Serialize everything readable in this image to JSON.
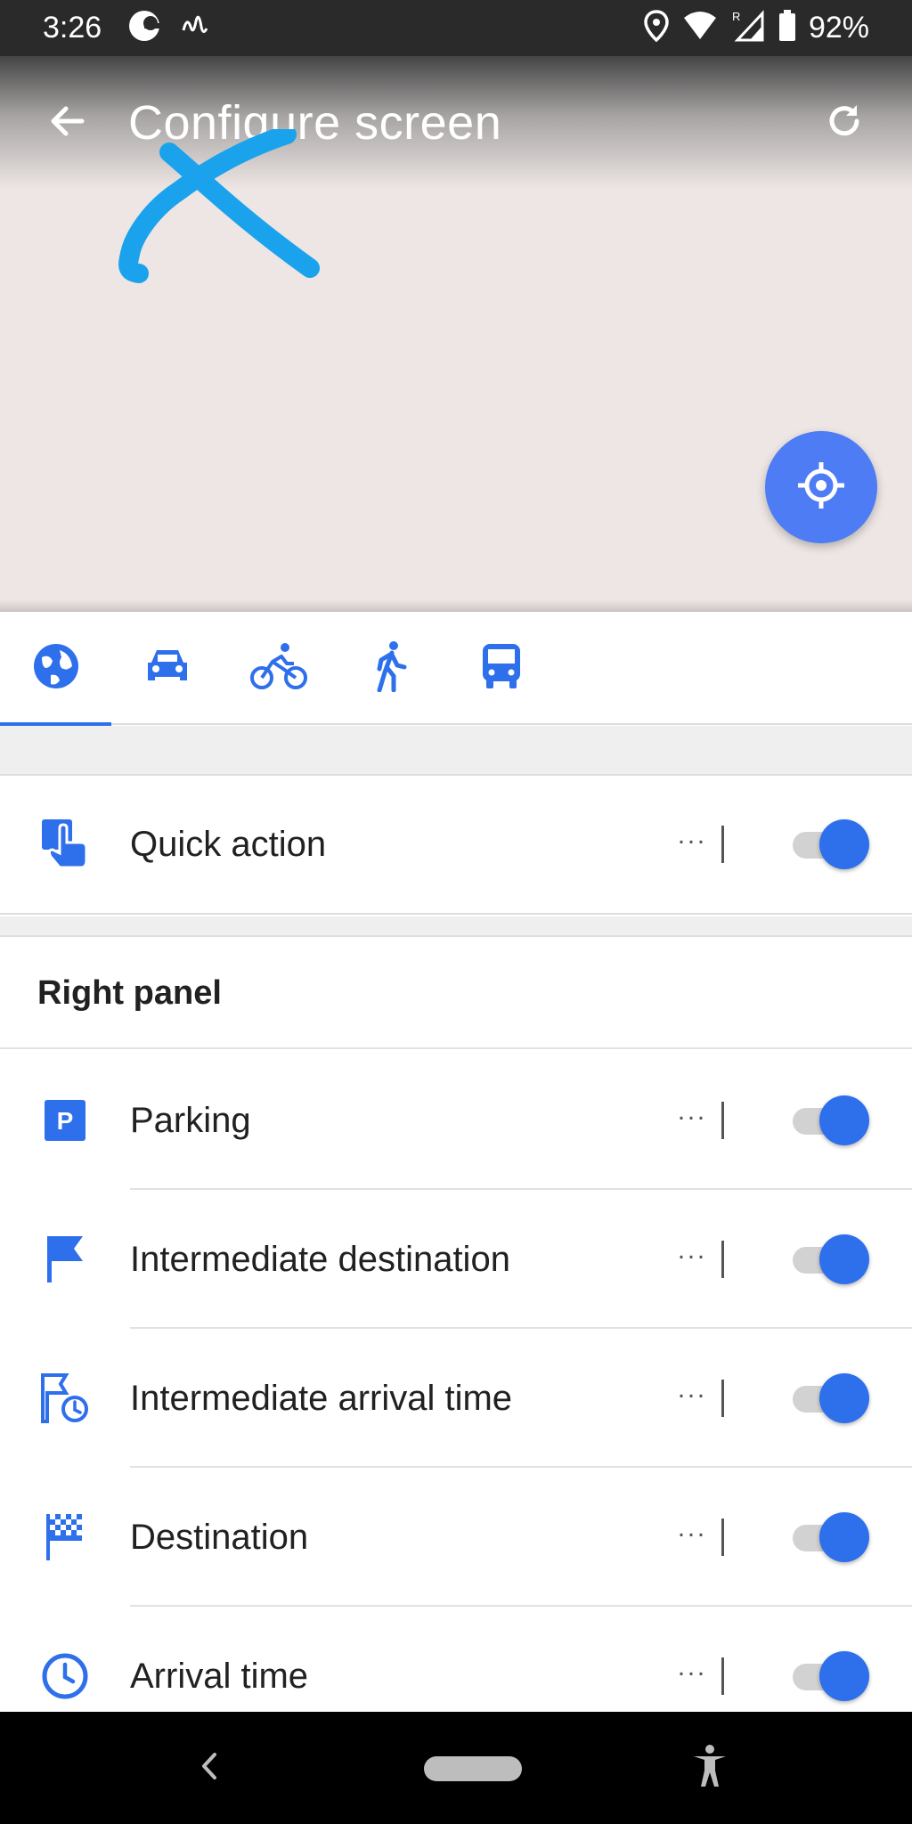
{
  "status_bar": {
    "time": "3:26",
    "battery_text": "92%",
    "icons": [
      "app-notification-icon",
      "signal-wave-icon",
      "location-pin-icon",
      "wifi-icon",
      "cell-signal-icon",
      "battery-icon"
    ]
  },
  "toolbar": {
    "title": "Configure screen",
    "back_icon": "arrow-back-icon",
    "reset_icon": "refresh-icon"
  },
  "map": {
    "location_button_icon": "my-location-icon",
    "background_color": "#ede6e4",
    "fab_color": "#4d7cf5"
  },
  "tabs": [
    {
      "icon": "globe-icon",
      "active": true
    },
    {
      "icon": "car-icon",
      "active": false
    },
    {
      "icon": "bicycle-icon",
      "active": false
    },
    {
      "icon": "pedestrian-icon",
      "active": false
    },
    {
      "icon": "bus-icon",
      "active": false
    }
  ],
  "quick_action": {
    "label": "Quick action",
    "icon": "touch-hand-icon",
    "more": "···",
    "enabled": true
  },
  "right_panel": {
    "title": "Right panel",
    "items": [
      {
        "label": "Parking",
        "icon": "parking-icon",
        "more": "···",
        "enabled": true
      },
      {
        "label": "Intermediate destination",
        "icon": "flag-icon",
        "more": "···",
        "enabled": true
      },
      {
        "label": "Intermediate arrival time",
        "icon": "flag-clock-icon",
        "more": "···",
        "enabled": true
      },
      {
        "label": "Destination",
        "icon": "checkered-flag-icon",
        "more": "···",
        "enabled": true
      },
      {
        "label": "Arrival time",
        "icon": "clock-icon",
        "more": "···",
        "enabled": true
      }
    ]
  },
  "colors": {
    "accent": "#2e6fec",
    "annotation_mark": "#1aa3ec"
  }
}
